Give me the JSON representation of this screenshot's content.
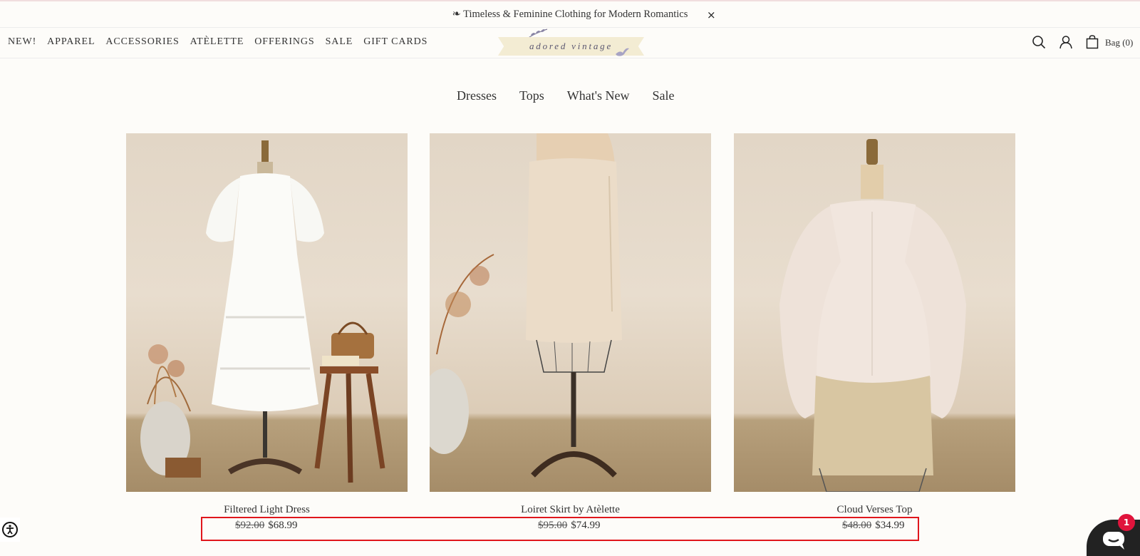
{
  "announcement": {
    "text": "❧ Timeless & Feminine Clothing for Modern Romantics",
    "close_glyph": "×"
  },
  "mainnav": [
    "NEW!",
    "APPAREL",
    "ACCESSORIES",
    "ATÈLETTE",
    "OFFERINGS",
    "SALE",
    "GIFT CARDS"
  ],
  "logo": {
    "text": "adored vintage"
  },
  "header": {
    "icons": [
      "search-icon",
      "account-icon",
      "bag-icon"
    ],
    "bag_label": "Bag (0)"
  },
  "categories": [
    "Dresses",
    "Tops",
    "What's New",
    "Sale"
  ],
  "products": [
    {
      "name": "Filtered Light Dress",
      "old_price": "$92.00",
      "price": "$68.99"
    },
    {
      "name": "Loiret Skirt by Atèlette",
      "old_price": "$95.00",
      "price": "$74.99"
    },
    {
      "name": "Cloud Verses Top",
      "old_price": "$48.00",
      "price": "$34.99"
    }
  ],
  "chat": {
    "badge": "1"
  },
  "colors": {
    "background": "#fdfcf9",
    "text": "#2e2e2e",
    "highlight_box": "#e0161c",
    "chat_button": "#222222",
    "chat_badge": "#e0143c",
    "logo_ribbon": "#f3ecd3"
  }
}
